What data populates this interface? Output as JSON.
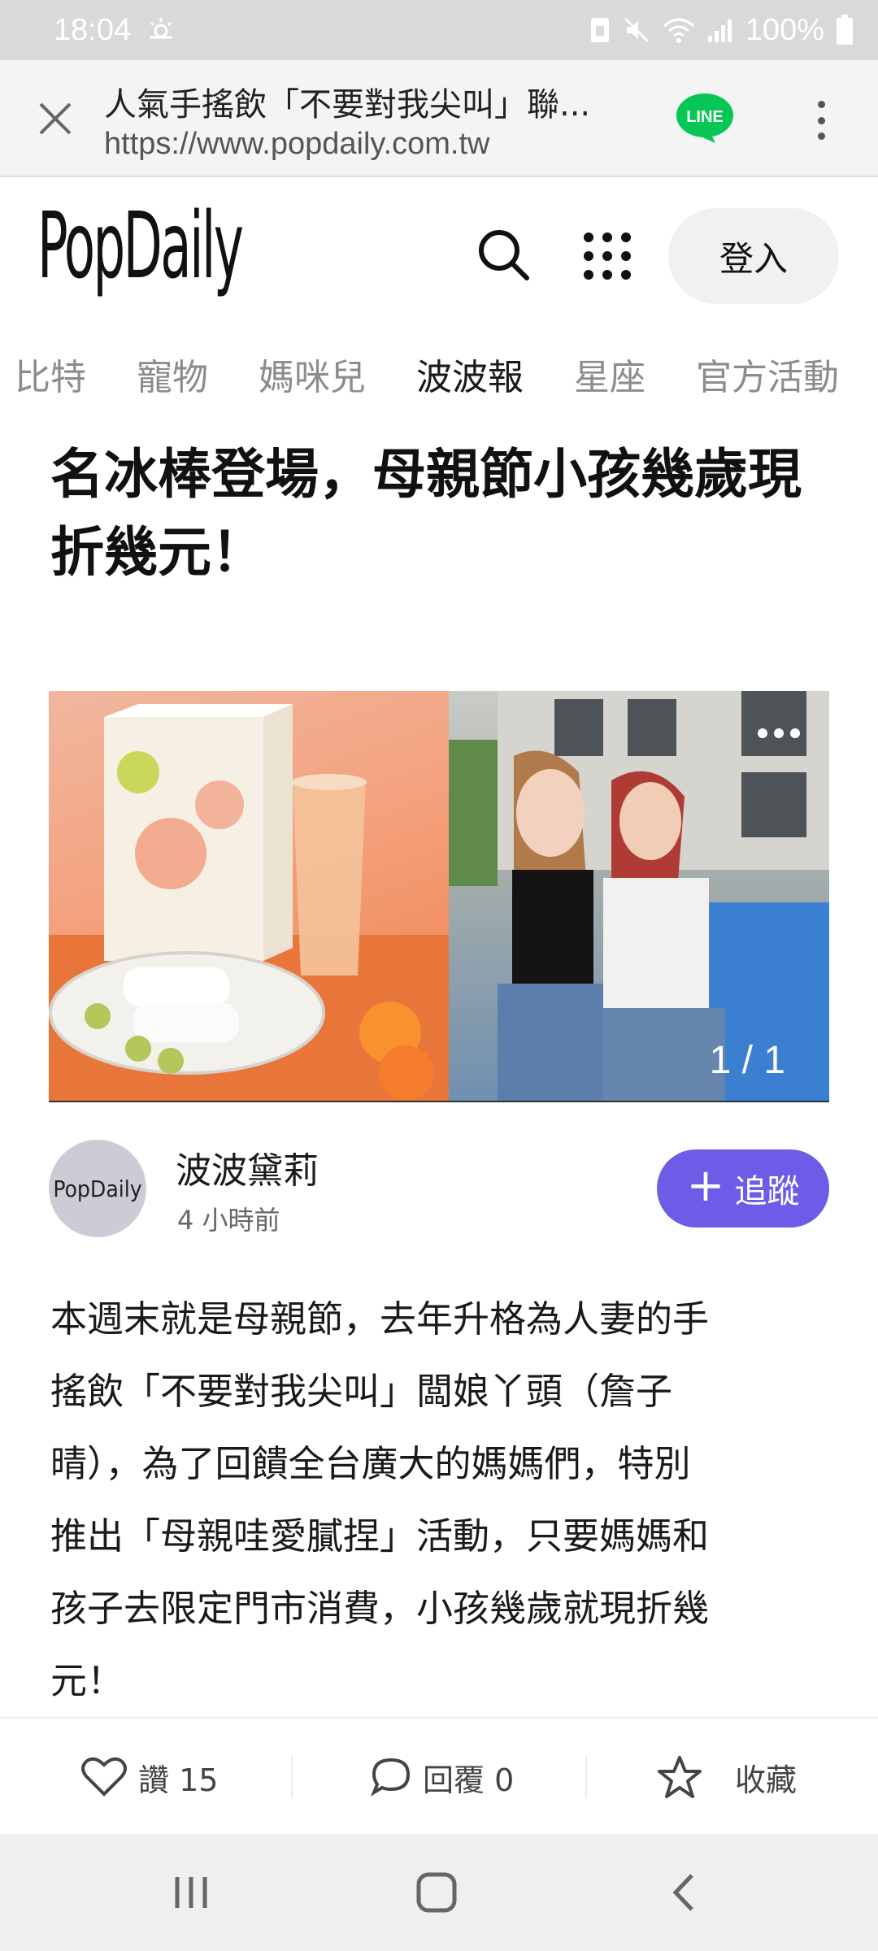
{
  "status_bar": {
    "time": "18:04",
    "battery": "100%",
    "icons": [
      "weather-icon",
      "sim-icon",
      "mute-icon",
      "wifi-icon",
      "signal-icon",
      "battery-icon"
    ]
  },
  "browser": {
    "title": "人氣手搖飲「不要對我尖叫」聯...",
    "url": "https://www.popdaily.com.tw",
    "share_app": "LINE"
  },
  "header": {
    "logo": "PopDaily",
    "login_label": "登入"
  },
  "categories": {
    "items": [
      "邱比特",
      "寵物",
      "媽咪兒",
      "波波報",
      "星座",
      "官方活動"
    ],
    "active": "波波報",
    "first_partial": "阝比特"
  },
  "article": {
    "title_line1": "人氣手搖飲「不要對我尖叫」聯",
    "title_line2": "名冰棒登場，母親節小孩幾歲現",
    "title_line3": "折幾元！",
    "image_counter": "1 / 1",
    "author": {
      "name": "波波黛莉",
      "time": "4 小時前",
      "avatar_text": "PopDaily"
    },
    "follow_label": "追蹤",
    "body": [
      "本週末就是母親節，去年升格為人妻的手",
      "搖飲「不要對我尖叫」闆娘丫頭（詹子",
      "晴），為了回饋全台廣大的媽媽們，特別",
      "推出「母親哇愛膩捏」活動，只要媽媽和",
      "孩子去限定門市消費，小孩幾歲就現折幾",
      "元！"
    ]
  },
  "actions": {
    "like_label": "讚 15",
    "reply_label": "回覆 0",
    "save_label": "收藏"
  },
  "colors": {
    "accent": "#6c5ce7",
    "line_green": "#06c755"
  }
}
